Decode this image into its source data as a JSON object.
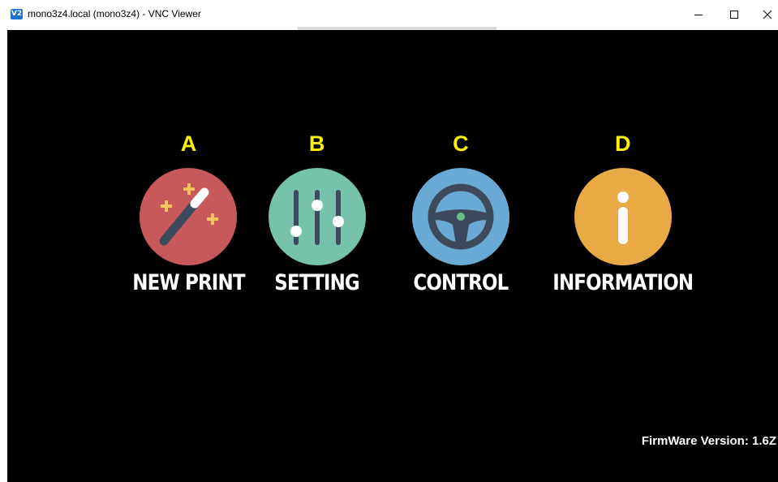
{
  "window": {
    "app_icon_text": "V2",
    "title": "mono3z4.local (mono3z4) - VNC Viewer",
    "minimize_icon": "minimize-icon",
    "maximize_icon": "maximize-icon",
    "close_icon": "close-icon"
  },
  "colors": {
    "letter": "#fff200",
    "new_print_bg": "#c8595a",
    "setting_bg": "#76c2ab",
    "control_bg": "#6aa9d3",
    "information_bg": "#e9aa46"
  },
  "menu": [
    {
      "letter": "A",
      "label": "NEW PRINT",
      "icon": "magic-wand-icon"
    },
    {
      "letter": "B",
      "label": "SETTING",
      "icon": "sliders-icon"
    },
    {
      "letter": "C",
      "label": "CONTROL",
      "icon": "steering-wheel-icon"
    },
    {
      "letter": "D",
      "label": "INFORMATION",
      "icon": "info-icon"
    }
  ],
  "footer": {
    "firmware": "FirmWare Version: 1.6Z"
  }
}
